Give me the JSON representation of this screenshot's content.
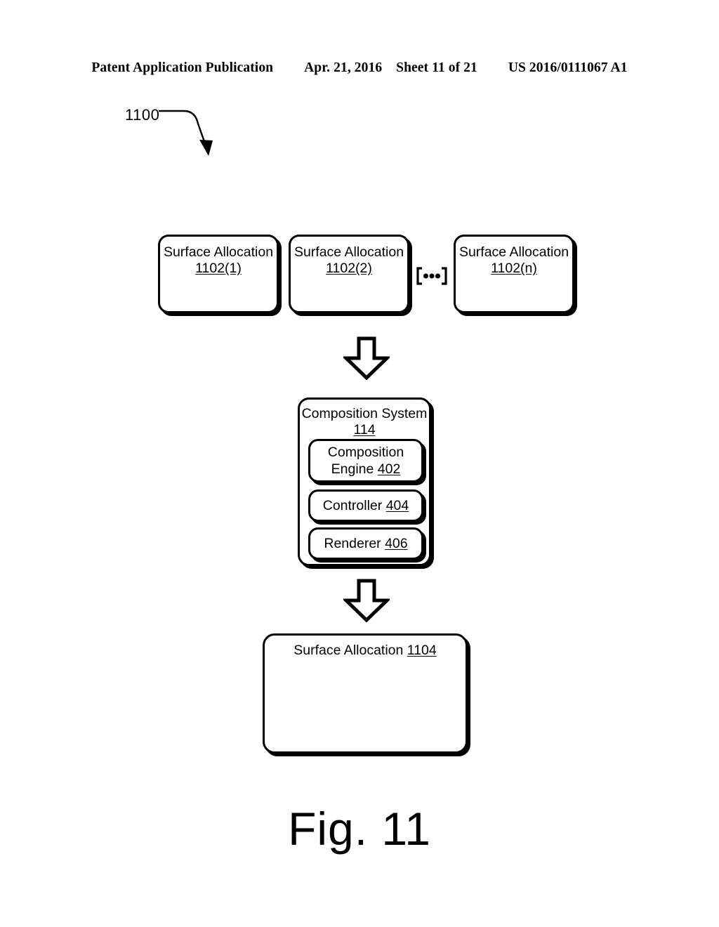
{
  "header": {
    "publication": "Patent Application Publication",
    "date": "Apr. 21, 2016",
    "sheet": "Sheet 11 of 21",
    "pub_number": "US 2016/0111067 A1"
  },
  "figure": {
    "ref_label": "1100",
    "caption": "Fig. 11",
    "ink_color": "#000000",
    "background_color": "#ffffff"
  },
  "inputs": {
    "boxes": [
      {
        "title": "Surface Allocation",
        "ref": "1102(1)"
      },
      {
        "title": "Surface Allocation",
        "ref": "1102(2)"
      },
      {
        "title": "Surface Allocation",
        "ref": "1102(n)"
      }
    ],
    "ellipsis": "(•••)"
  },
  "composition_system": {
    "title": "Composition System",
    "ref": "114",
    "components": [
      {
        "line1": "Composition",
        "line2": "Engine",
        "ref": "402"
      },
      {
        "line1": "Controller",
        "ref": "404"
      },
      {
        "line1": "Renderer",
        "ref": "406"
      }
    ]
  },
  "output": {
    "title": "Surface Allocation",
    "ref": "1104"
  },
  "flow": {
    "arrow_1": "down-block-arrow",
    "arrow_2": "down-block-arrow"
  }
}
